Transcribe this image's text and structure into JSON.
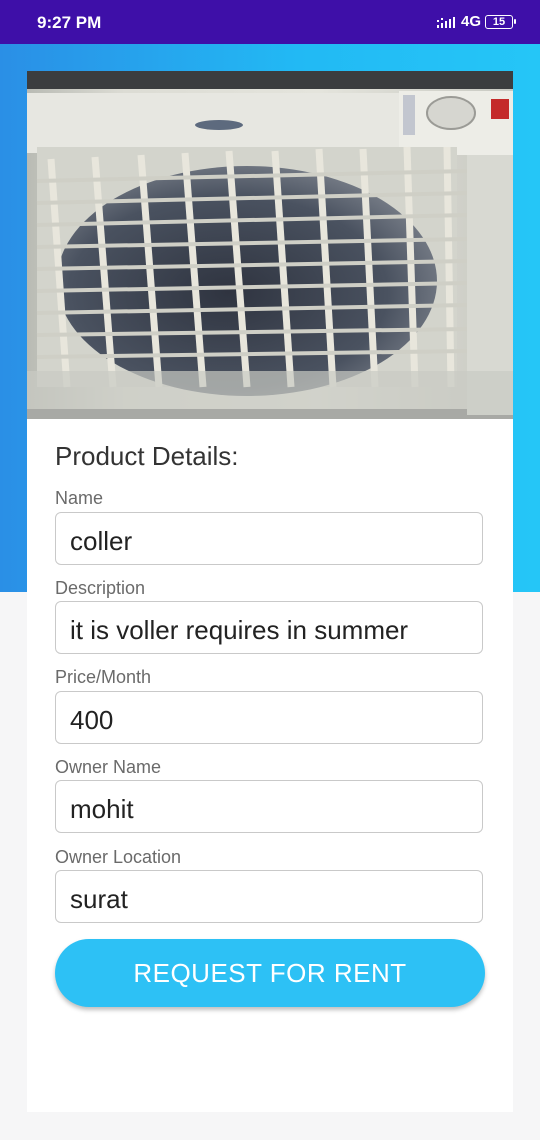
{
  "status_bar": {
    "time": "9:27 PM",
    "network": "4G",
    "battery": "15",
    "icons": [
      "signal-icon",
      "battery-icon"
    ]
  },
  "product": {
    "image_icon": "air-cooler-photo",
    "section_title": "Product Details:",
    "fields": [
      {
        "label": "Name",
        "value": "coller"
      },
      {
        "label": "Description",
        "value": "it is voller requires in summer"
      },
      {
        "label": "Price/Month",
        "value": "400"
      },
      {
        "label": "Owner Name",
        "value": "mohit"
      },
      {
        "label": "Owner Location",
        "value": "surat"
      }
    ],
    "request_button": "REQUEST FOR RENT"
  },
  "colors": {
    "status_bar": "#3e0fa8",
    "header_gradient_start": "#2a8fe6",
    "header_gradient_end": "#25c6f7",
    "button": "#2dc1f5"
  }
}
